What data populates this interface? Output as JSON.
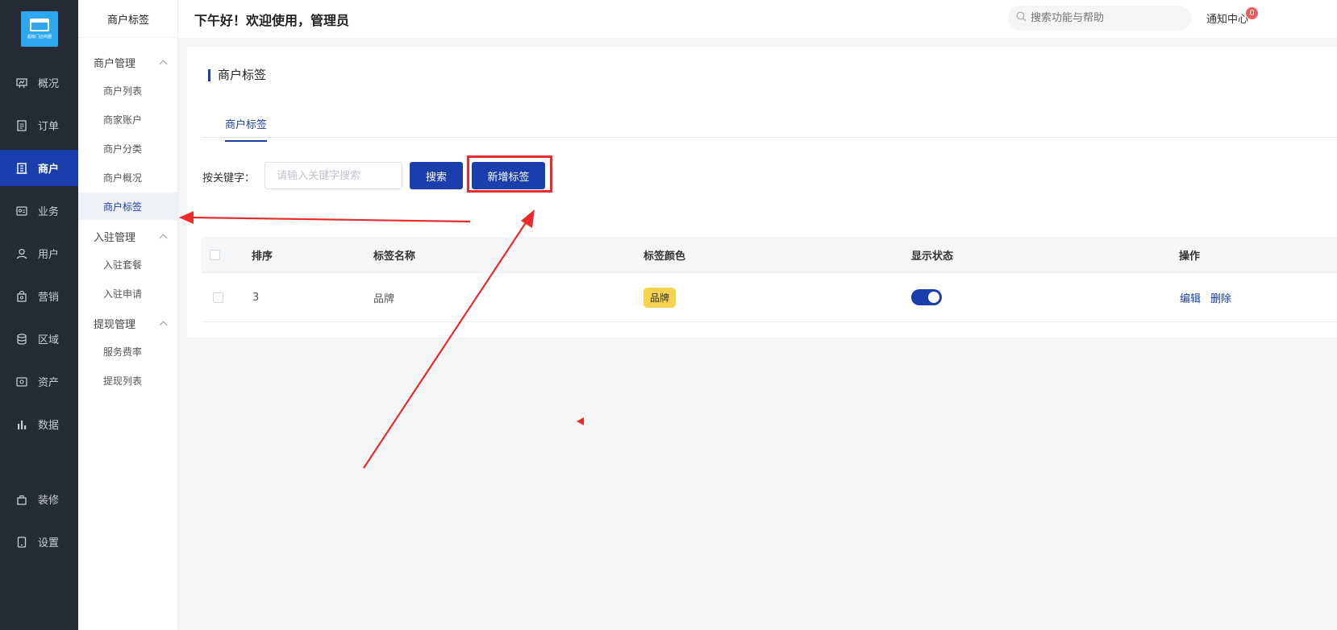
{
  "nav": {
    "logo_caption": "超级门店商圈",
    "items": [
      {
        "label": "概况",
        "icon": "chart-board-icon"
      },
      {
        "label": "订单",
        "icon": "document-list-icon"
      },
      {
        "label": "商户",
        "icon": "building-icon"
      },
      {
        "label": "业务",
        "icon": "business-card-icon"
      },
      {
        "label": "用户",
        "icon": "user-icon"
      },
      {
        "label": "营销",
        "icon": "bag-icon"
      },
      {
        "label": "区域",
        "icon": "database-icon"
      },
      {
        "label": "资产",
        "icon": "wallet-icon"
      },
      {
        "label": "数据",
        "icon": "bar-chart-icon"
      },
      {
        "label": "装修",
        "icon": "paint-bag-icon"
      },
      {
        "label": "设置",
        "icon": "tablet-icon"
      }
    ],
    "active": "商户"
  },
  "subnav": {
    "title": "商户标签",
    "groups": [
      {
        "label": "商户管理",
        "items": [
          "商户列表",
          "商家账户",
          "商户分类",
          "商户概况",
          "商户标签"
        ]
      },
      {
        "label": "入驻管理",
        "items": [
          "入驻套餐",
          "入驻申请"
        ]
      },
      {
        "label": "提现管理",
        "items": [
          "服务费率",
          "提现列表"
        ]
      }
    ],
    "active": "商户标签"
  },
  "topbar": {
    "greeting": "下午好！欢迎使用，管理员",
    "search_placeholder": "搜索功能与帮助",
    "notice_label": "通知中心",
    "notice_count": "0"
  },
  "page": {
    "title": "商户标签",
    "tab": "商户标签",
    "filter_label": "按关键字：",
    "filter_placeholder": "请输入关键字搜索",
    "search_button": "搜索",
    "add_button": "新增标签"
  },
  "table": {
    "headers": {
      "order": "排序",
      "name": "标签名称",
      "color": "标签颜色",
      "status": "显示状态",
      "ops": "操作"
    },
    "rows": [
      {
        "order": "3",
        "name": "品牌",
        "color_tag": "品牌",
        "enabled": true,
        "edit": "编辑",
        "delete": "删除"
      }
    ]
  },
  "colors": {
    "primary": "#1a3eac",
    "nav_bg": "#242a36",
    "tag_yellow": "#f5d34e",
    "annotation_red": "#ea2b2b"
  }
}
